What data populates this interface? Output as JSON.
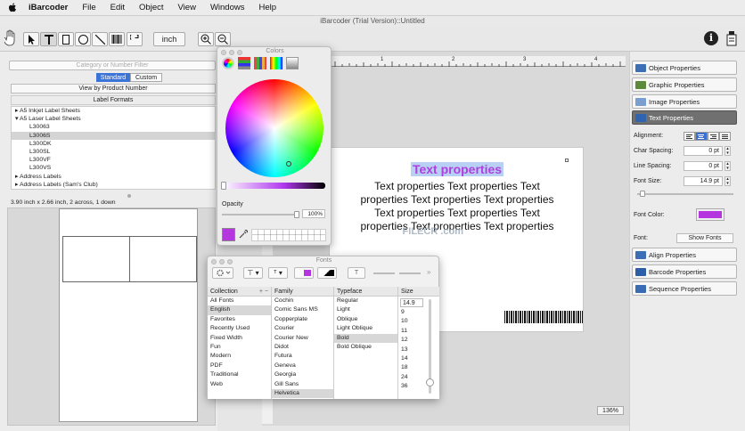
{
  "menubar": {
    "apple": "",
    "app": "iBarcoder",
    "items": [
      "File",
      "Edit",
      "Object",
      "View",
      "Windows",
      "Help"
    ]
  },
  "window": {
    "title": "iBarcoder (Trial Version)::Untitled"
  },
  "toolbar": {
    "units": "inch"
  },
  "left": {
    "search_placeholder": "Category or Number Filter",
    "seg_standard": "Standard",
    "seg_custom": "Custom",
    "view_by_product": "View by Product Number",
    "label_formats": "Label Formats",
    "tree": [
      {
        "label": "A5 Inkjet Label Sheets",
        "kind": "group",
        "open": false
      },
      {
        "label": "A5 Laser Label Sheets",
        "kind": "group",
        "open": true
      },
      {
        "label": "L30063",
        "kind": "child"
      },
      {
        "label": "L3006S",
        "kind": "child",
        "selected": true
      },
      {
        "label": "L300DK",
        "kind": "child"
      },
      {
        "label": "L300SL",
        "kind": "child"
      },
      {
        "label": "L300VF",
        "kind": "child"
      },
      {
        "label": "L300VS",
        "kind": "child"
      },
      {
        "label": "Address Labels",
        "kind": "group",
        "open": false
      },
      {
        "label": "Address Labels (Sam's Club)",
        "kind": "group",
        "open": false
      }
    ],
    "info": "3.90 inch x 2.66 inch, 2 across, 1 down"
  },
  "canvas": {
    "heading": "Text properties",
    "body_lines": [
      "Text properties Text properties Text",
      "properties Text properties Text properties",
      "Text properties Text properties Text",
      "properties Text properties Text properties"
    ],
    "ruler_ticks": [
      "1",
      "2",
      "3",
      "4"
    ],
    "zoom": "136%",
    "watermark": "FILECR .com"
  },
  "right": {
    "object_properties": "Object Properties",
    "graphic_properties": "Graphic Properties",
    "image_properties": "Image Properties",
    "text_properties": "Text Properties",
    "alignment_label": "Alignment:",
    "char_spacing_label": "Char Spacing:",
    "char_spacing": "0 pt",
    "line_spacing_label": "Line Spacing:",
    "line_spacing": "0 pt",
    "font_size_label": "Font Size:",
    "font_size": "14.9 pt",
    "font_color_label": "Font Color:",
    "font_label": "Font:",
    "show_fonts": "Show Fonts",
    "align_properties": "Align Properties",
    "barcode_properties": "Barcode Properties",
    "sequence_properties": "Sequence Properties",
    "font_color": "#b535df"
  },
  "colors_panel": {
    "title": "Colors",
    "opacity_label": "Opacity",
    "opacity_value": "100%",
    "current_color": "#b535df"
  },
  "fonts_panel": {
    "title": "Fonts",
    "collection_header": "Collection",
    "family_header": "Family",
    "typeface_header": "Typeface",
    "size_header": "Size",
    "size_value": "14.9",
    "collections": [
      "All Fonts",
      "English",
      "Favorites",
      "Recently Used",
      "Fixed Width",
      "Fun",
      "Modern",
      "PDF",
      "Traditional",
      "Web"
    ],
    "families": [
      "Cochin",
      "Comic Sans MS",
      "Copperplate",
      "Courier",
      "Courier New",
      "Didot",
      "Futura",
      "Geneva",
      "Georgia",
      "Gill Sans",
      "Helvetica"
    ],
    "typefaces": [
      "Regular",
      "Light",
      "Oblique",
      "Light Oblique",
      "Bold",
      "Bold Oblique"
    ],
    "sizes": [
      "9",
      "10",
      "11",
      "12",
      "13",
      "14",
      "18",
      "24",
      "36"
    ]
  }
}
